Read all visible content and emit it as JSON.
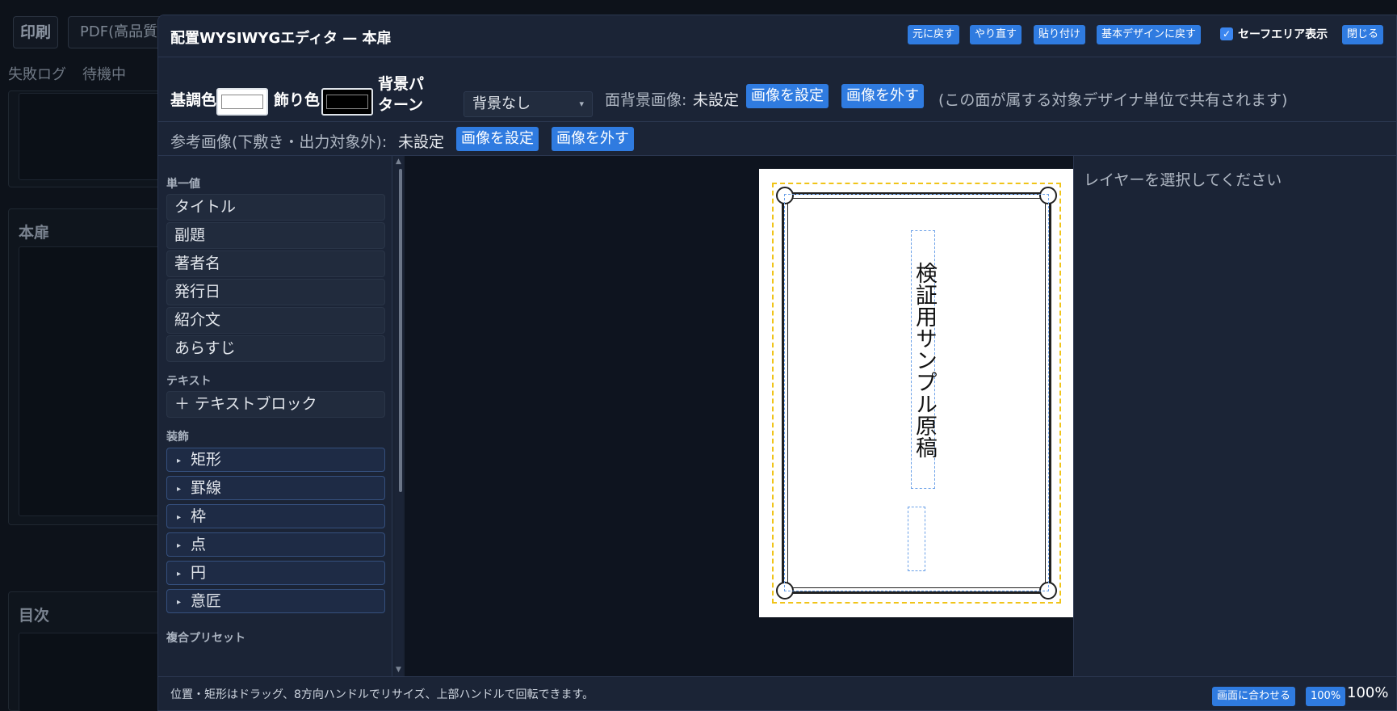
{
  "background": {
    "print_label": "印刷",
    "pdf_label": "PDF(高品質",
    "tabs": [
      "失敗ログ",
      "待機中"
    ],
    "section_titles": [
      "本扉",
      "目次"
    ]
  },
  "editor": {
    "title": "配置WYSIWYGエディタ — 本扉",
    "header_buttons": {
      "undo": "元に戻す",
      "redo": "やり直す",
      "paste": "貼り付け",
      "reset": "基本デザインに戻す",
      "close": "閉じる"
    },
    "safe_area": {
      "label": "セーフエリア表示",
      "checked": true,
      "check_glyph": "✓"
    },
    "colors": {
      "base_label": "基調色",
      "base_value": "#ffffff",
      "accent_label": "飾り色",
      "accent_value": "#000000",
      "pattern_label": "背景パターン",
      "pattern_value": "背景なし",
      "caret": "▾"
    },
    "face_bg": {
      "label": "面背景画像:",
      "status": "未設定",
      "set_button": "画像を設定",
      "remove_button": "画像を外す",
      "note": "(この面が属する対象デザイナ単位で共有されます)"
    },
    "reference": {
      "label": "参考画像(下敷き・出力対象外):",
      "status": "未設定",
      "set_button": "画像を設定",
      "remove_button": "画像を外す"
    },
    "palette": {
      "single_value_title": "単一値",
      "single_values": [
        "タイトル",
        "副題",
        "著者名",
        "発行日",
        "紹介文",
        "あらすじ"
      ],
      "text_title": "テキスト",
      "text_block": "＋ テキストブロック",
      "decor_title": "装飾",
      "decor_triangle": "▸",
      "decor_items": [
        "矩形",
        "罫線",
        "枠",
        "点",
        "円",
        "意匠"
      ],
      "preset_title": "複合プリセット",
      "scroll_up": "▲",
      "scroll_down": "▼"
    },
    "canvas": {
      "title_text": "検証用サンプル原稿"
    },
    "props": {
      "empty_message": "レイヤーを選択してください"
    },
    "footer": {
      "hint": "位置・矩形はドラッグ、8方向ハンドルでリサイズ、上部ハンドルで回転できます。",
      "fit_button": "画面に合わせる",
      "zoom_100_button": "100%",
      "zoom_level": "100%"
    }
  }
}
